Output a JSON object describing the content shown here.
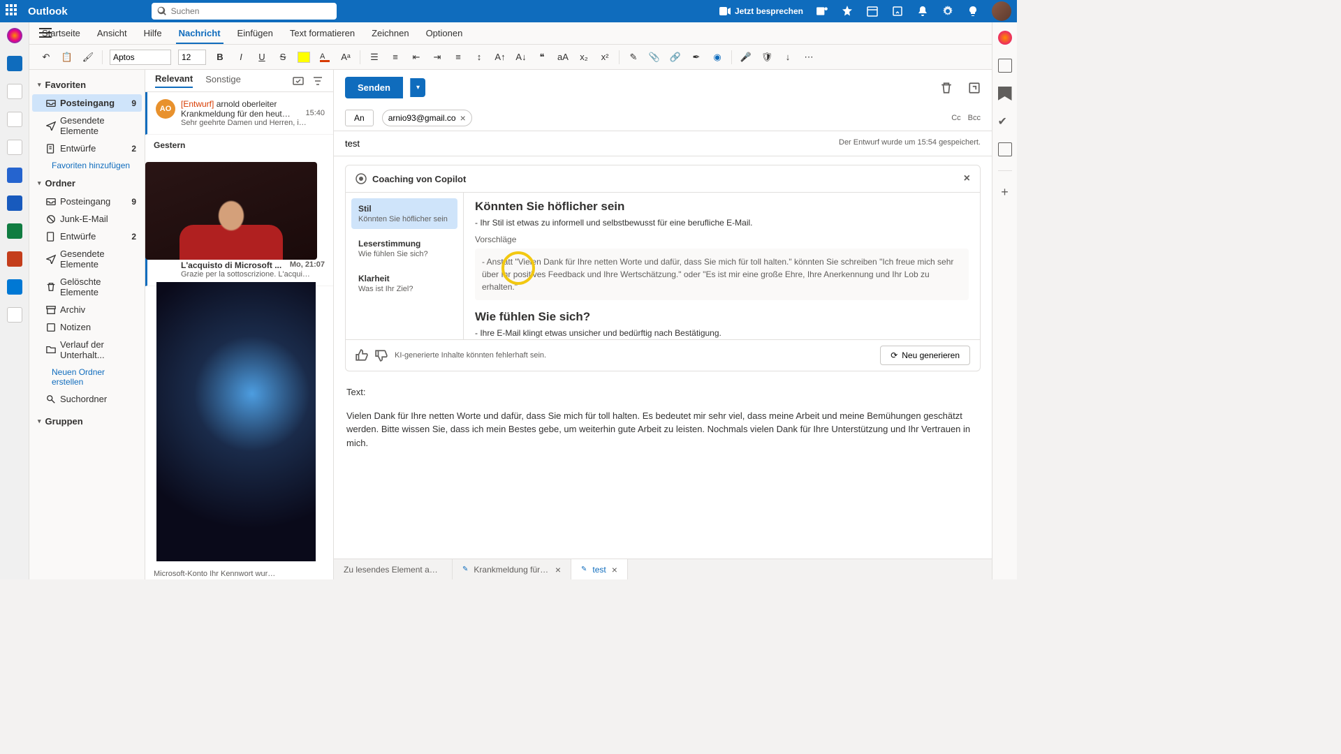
{
  "header": {
    "app_name": "Outlook",
    "search_placeholder": "Suchen",
    "meet_now": "Jetzt besprechen"
  },
  "ribbon": {
    "tabs": [
      "Startseite",
      "Ansicht",
      "Hilfe",
      "Nachricht",
      "Einfügen",
      "Text formatieren",
      "Zeichnen",
      "Optionen"
    ],
    "active_index": 3
  },
  "toolbar": {
    "font": "Aptos",
    "size": "12"
  },
  "folders": {
    "favorites_label": "Favoriten",
    "favorites": [
      {
        "icon": "inbox",
        "name": "Posteingang",
        "count": "9",
        "active": true
      },
      {
        "icon": "sent",
        "name": "Gesendete Elemente"
      },
      {
        "icon": "drafts",
        "name": "Entwürfe",
        "count": "2"
      }
    ],
    "add_favorites": "Favoriten hinzufügen",
    "folders_label": "Ordner",
    "items": [
      {
        "icon": "inbox",
        "name": "Posteingang",
        "count": "9"
      },
      {
        "icon": "junk",
        "name": "Junk-E-Mail"
      },
      {
        "icon": "drafts",
        "name": "Entwürfe",
        "count": "2"
      },
      {
        "icon": "sent",
        "name": "Gesendete Elemente"
      },
      {
        "icon": "deleted",
        "name": "Gelöschte Elemente"
      },
      {
        "icon": "archive",
        "name": "Archiv"
      },
      {
        "icon": "notes",
        "name": "Notizen"
      },
      {
        "icon": "history",
        "name": "Verlauf der Unterhalt..."
      }
    ],
    "new_folder": "Neuen Ordner erstellen",
    "search_folders": "Suchordner",
    "groups_label": "Gruppen"
  },
  "msglist": {
    "pivot_focused": "Relevant",
    "pivot_other": "Sonstige",
    "item1": {
      "avatar": "AO",
      "draft_tag": "[Entwurf]",
      "from": "arnold oberleiter",
      "subject": "Krankmeldung für den heut…",
      "time": "15:40",
      "preview": "Sehr geehrte Damen und Herren, i…"
    },
    "date_yesterday": "Gestern",
    "item2": {
      "from": "L'acquisto di Microsoft ...",
      "time": "Mo, 21:07",
      "preview": "Grazie per la sottoscrizione. L'acqui…"
    },
    "item3_preview": "Microsoft-Konto Ihr Kennwort wur…"
  },
  "compose": {
    "send": "Senden",
    "to_label": "An",
    "recipient": "arnio93@gmail.co",
    "cc": "Cc",
    "bcc": "Bcc",
    "subject": "test",
    "saved_info": "Der Entwurf wurde um 15:54 gespeichert.",
    "body_label": "Text:",
    "body": "Vielen Dank für Ihre netten Worte und dafür, dass Sie mich für toll halten. Es bedeutet mir sehr viel, dass meine Arbeit und meine Bemühungen geschätzt werden. Bitte wissen Sie, dass ich mein Bestes gebe, um weiterhin gute Arbeit zu leisten. Nochmals vielen Dank für Ihre Unterstützung und Ihr Vertrauen in mich."
  },
  "copilot": {
    "title": "Coaching von Copilot",
    "tabs": [
      {
        "title": "Stil",
        "sub": "Könnten Sie höflicher sein"
      },
      {
        "title": "Leserstimmung",
        "sub": "Wie fühlen Sie sich?"
      },
      {
        "title": "Klarheit",
        "sub": "Was ist Ihr Ziel?"
      }
    ],
    "h1": "Könnten Sie höflicher sein",
    "p1": "- Ihr Stil ist etwas zu informell und selbstbewusst für eine berufliche E-Mail.",
    "suggest_label": "Vorschläge",
    "suggest_text": "- Anstatt \"Vielen Dank für Ihre netten Worte und dafür, dass Sie mich für toll halten.\" könnten Sie schreiben \"Ich freue mich sehr über Ihr positives Feedback und Ihre Wertschätzung.\" oder \"Es ist mir eine große Ehre, Ihre Anerkennung und Ihr Lob zu erhalten.\"",
    "h2": "Wie fühlen Sie sich?",
    "p2": "- Ihre E-Mail klingt etwas unsicher und bedürftig nach Bestätigung.",
    "disclaimer": "KI-generierte Inhalte könnten fehlerhaft sein.",
    "regenerate": "Neu generieren"
  },
  "bottom_tabs": {
    "t1": "Zu lesendes Element ausw…",
    "t2": "Krankmeldung für …",
    "t3": "test"
  }
}
